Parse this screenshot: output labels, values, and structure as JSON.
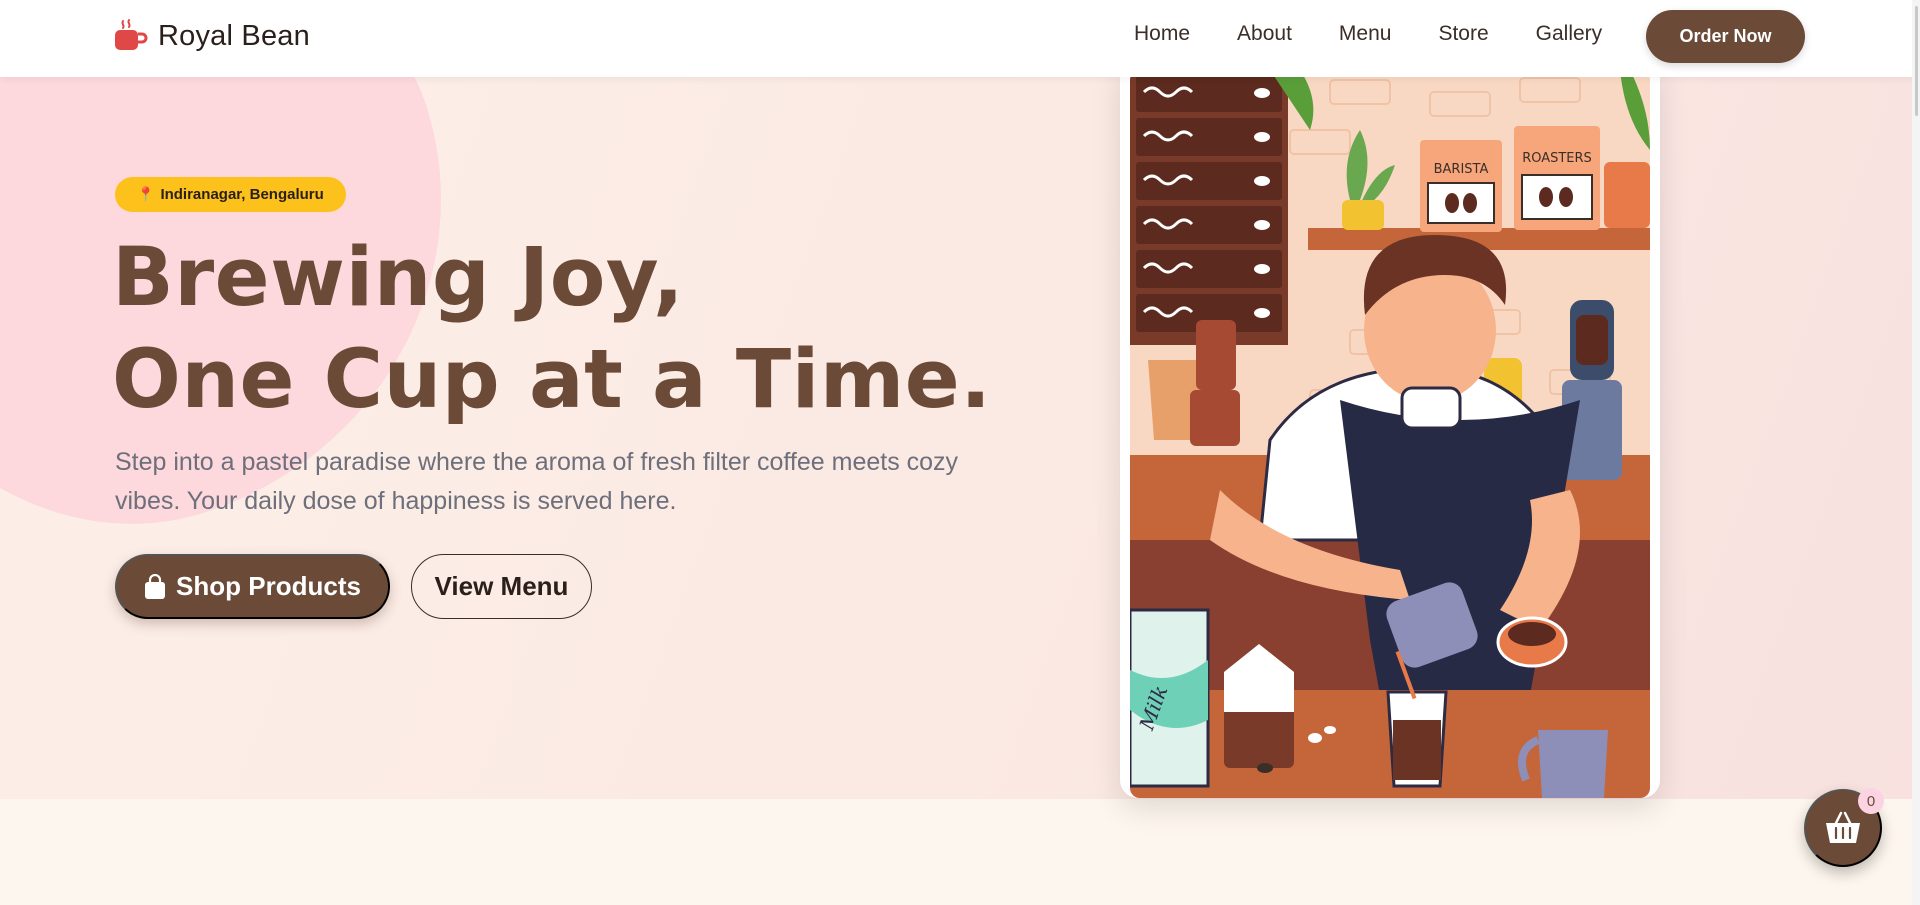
{
  "brand": {
    "name": "Royal Bean",
    "icon": "coffee-cup-icon",
    "accent": "#e04848"
  },
  "nav": {
    "links": [
      "Home",
      "About",
      "Menu",
      "Store",
      "Gallery"
    ],
    "order_label": "Order Now"
  },
  "hero": {
    "location": "Indiranagar, Bengaluru",
    "headline_line1": "Brewing Joy,",
    "headline_line2": "One Cup at a Time.",
    "subtext": "Step into a pastel paradise where the aroma of fresh filter coffee meets cozy vibes. Your daily dose of happiness is served here.",
    "shop_label": "Shop Products",
    "menu_label": "View Menu",
    "illustration": {
      "bag_labels": [
        "BARISTA",
        "ROASTERS"
      ],
      "carton_label": "Milk"
    }
  },
  "cart": {
    "count": "0",
    "icon": "basket-icon"
  },
  "colors": {
    "primary": "#6b4a37",
    "badge": "#fcc21b",
    "blob": "#fdd9de"
  }
}
